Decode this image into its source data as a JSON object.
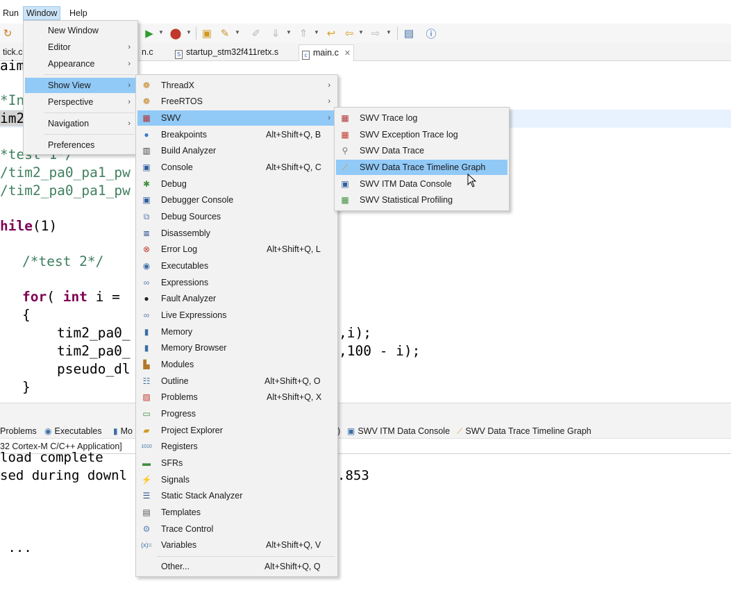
{
  "menubar": {
    "run": "Run",
    "window": "Window",
    "help": "Help"
  },
  "tabs": [
    {
      "label": "tick.c"
    },
    {
      "label": "n.c"
    },
    {
      "label": "startup_stm32f411retx.s"
    },
    {
      "label": "main.c"
    }
  ],
  "editor": {
    "lines": {
      "l1": "aim",
      "l2": "*In",
      "l3": "im2",
      "l4": "*test 1*/",
      "l5": "/tim2_pa0_pa1_pw",
      "l6": "/tim2_pa0_pa1_pw",
      "l7_kw": "hile",
      "l7_rest": "(1)",
      "l8": "/*test 2*/",
      "l9_kw1": "for",
      "l9_mid": "( ",
      "l9_kw2": "int",
      "l9_rest": " i =",
      "l10": "{",
      "l11a": "tim2_pa0_",
      "l11b": ",i);",
      "l12a": "tim2_pa0_",
      "l12b": ",100 - i);",
      "l13a": "pseudo_dl",
      "l14": "}"
    }
  },
  "bottom_panel": {
    "tabs": {
      "problems": "Problems",
      "executables": "Executables",
      "mem": "Mo",
      "itm": "SWV ITM Data Console",
      "timeline": "SWV Data Trace Timeline Graph",
      "paren": ")"
    },
    "console_title": "32 Cortex-M C/C++ Application]",
    "lines": {
      "c1": "load complete",
      "c2": "sed during downl",
      "c2b": ".853",
      "c3": " ..."
    }
  },
  "window_menu": {
    "items": {
      "new_window": "New Window",
      "editor": "Editor",
      "appearance": "Appearance",
      "show_view": "Show View",
      "perspective": "Perspective",
      "navigation": "Navigation",
      "preferences": "Preferences"
    }
  },
  "show_view_menu": {
    "threadx": "ThreadX",
    "freertos": "FreeRTOS",
    "swv": "SWV",
    "breakpoints": {
      "label": "Breakpoints",
      "shortcut": "Alt+Shift+Q, B"
    },
    "build_analyzer": "Build Analyzer",
    "console": {
      "label": "Console",
      "shortcut": "Alt+Shift+Q, C"
    },
    "debug": "Debug",
    "debugger_console": "Debugger Console",
    "debug_sources": "Debug Sources",
    "disassembly": "Disassembly",
    "error_log": {
      "label": "Error Log",
      "shortcut": "Alt+Shift+Q, L"
    },
    "executables": "Executables",
    "expressions": "Expressions",
    "fault_analyzer": "Fault Analyzer",
    "live_expressions": "Live Expressions",
    "memory": "Memory",
    "memory_browser": "Memory Browser",
    "modules": "Modules",
    "outline": {
      "label": "Outline",
      "shortcut": "Alt+Shift+Q, O"
    },
    "problems": {
      "label": "Problems",
      "shortcut": "Alt+Shift+Q, X"
    },
    "progress": "Progress",
    "project_explorer": "Project Explorer",
    "registers": "Registers",
    "sfrs": "SFRs",
    "signals": "Signals",
    "static_stack": "Static Stack Analyzer",
    "templates": "Templates",
    "trace_control": "Trace Control",
    "variables": {
      "label": "Variables",
      "shortcut": "Alt+Shift+Q, V",
      "icon_text": "(x)="
    },
    "other": {
      "label": "Other...",
      "shortcut": "Alt+Shift+Q, Q"
    }
  },
  "swv_menu": {
    "trace_log": "SWV Trace log",
    "exception_trace_log": "SWV Exception Trace log",
    "data_trace": "SWV Data Trace",
    "timeline_graph": "SWV Data Trace Timeline Graph",
    "itm_console": "SWV ITM Data Console",
    "statistical_profiling": "SWV Statistical Profiling"
  },
  "colors": {
    "menu_highlight": "#91c9f7",
    "menubar_active": "#cce4f7",
    "keyword": "#7f0055",
    "comment": "#3f7f5f"
  }
}
